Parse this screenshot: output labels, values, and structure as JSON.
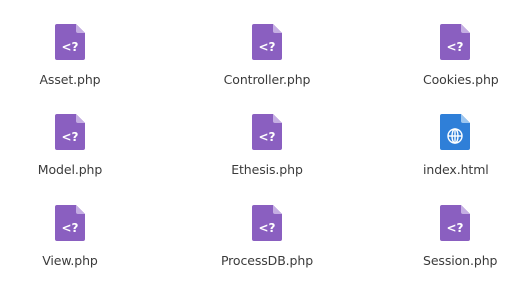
{
  "colors": {
    "php_icon_body": "#8a5fc0",
    "php_icon_fold": "#c5aee3",
    "html_icon_body": "#2f7fd8",
    "html_icon_fold": "#9cc6f0",
    "label_text": "#3b3b3b",
    "background": "#ffffff"
  },
  "files": [
    {
      "name": "Asset.php",
      "icon": "php-file-icon",
      "glyph": "<?"
    },
    {
      "name": "Controller.php",
      "icon": "php-file-icon",
      "glyph": "<?"
    },
    {
      "name": "Cookies.php",
      "icon": "php-file-icon",
      "glyph": "<?"
    },
    {
      "name": "Model.php",
      "icon": "php-file-icon",
      "glyph": "<?"
    },
    {
      "name": "Ethesis.php",
      "icon": "php-file-icon",
      "glyph": "<?"
    },
    {
      "name": "index.html",
      "icon": "html-file-icon",
      "glyph": ""
    },
    {
      "name": "View.php",
      "icon": "php-file-icon",
      "glyph": "<?"
    },
    {
      "name": "ProcessDB.php",
      "icon": "php-file-icon",
      "glyph": "<?"
    },
    {
      "name": "Session.php",
      "icon": "php-file-icon",
      "glyph": "<?"
    }
  ]
}
